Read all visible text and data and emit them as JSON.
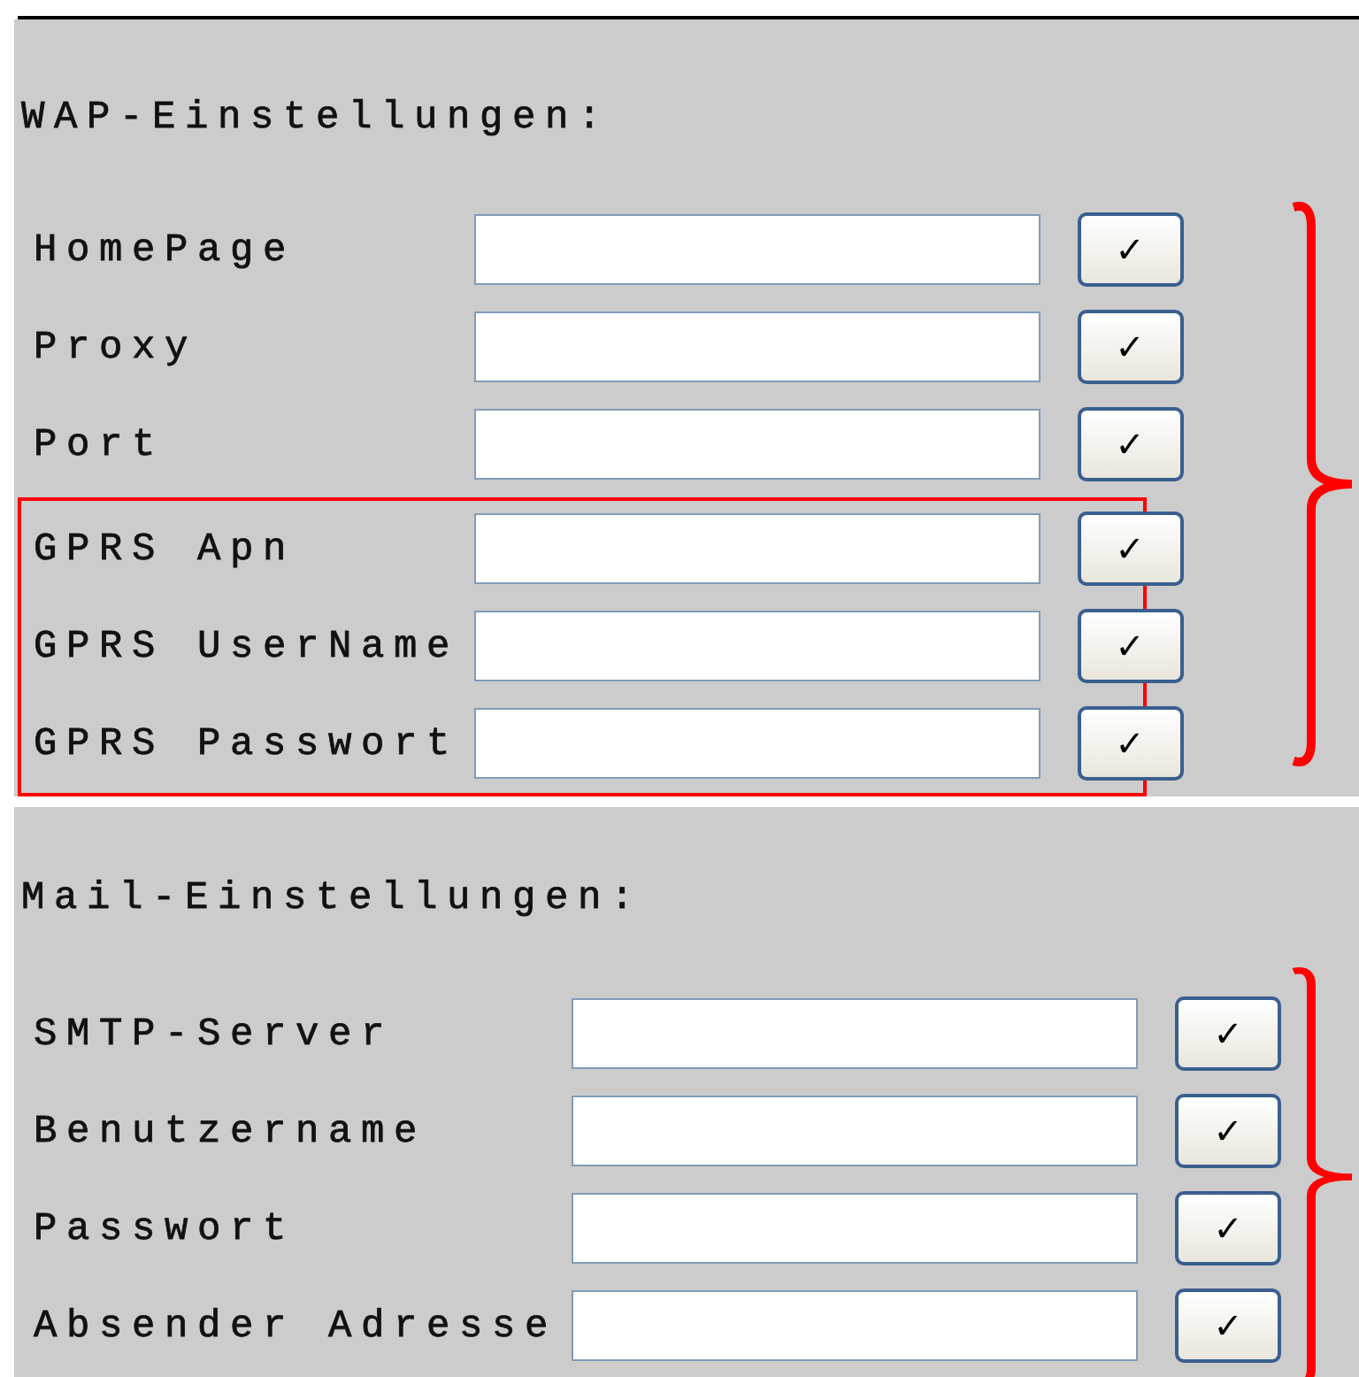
{
  "sections": [
    {
      "title": "WAP-Einstellungen:",
      "rows": [
        {
          "label": "HomePage",
          "button": "✓",
          "highlighted": false
        },
        {
          "label": "Proxy",
          "button": "✓",
          "highlighted": false
        },
        {
          "label": "Port",
          "button": "✓",
          "highlighted": false
        },
        {
          "label": "GPRS Apn",
          "button": "✓",
          "highlighted": true
        },
        {
          "label": "GPRS UserName",
          "button": "✓",
          "highlighted": true
        },
        {
          "label": "GPRS Passwort",
          "button": "✓",
          "highlighted": true
        }
      ]
    },
    {
      "title": "Mail-Einstellungen:",
      "rows": [
        {
          "label": "SMTP-Server",
          "button": "✓",
          "highlighted": false
        },
        {
          "label": "Benutzername",
          "button": "✓",
          "highlighted": false
        },
        {
          "label": "Passwort",
          "button": "✓",
          "highlighted": false
        },
        {
          "label": "Absender Adresse",
          "button": "✓",
          "highlighted": false
        }
      ]
    }
  ]
}
